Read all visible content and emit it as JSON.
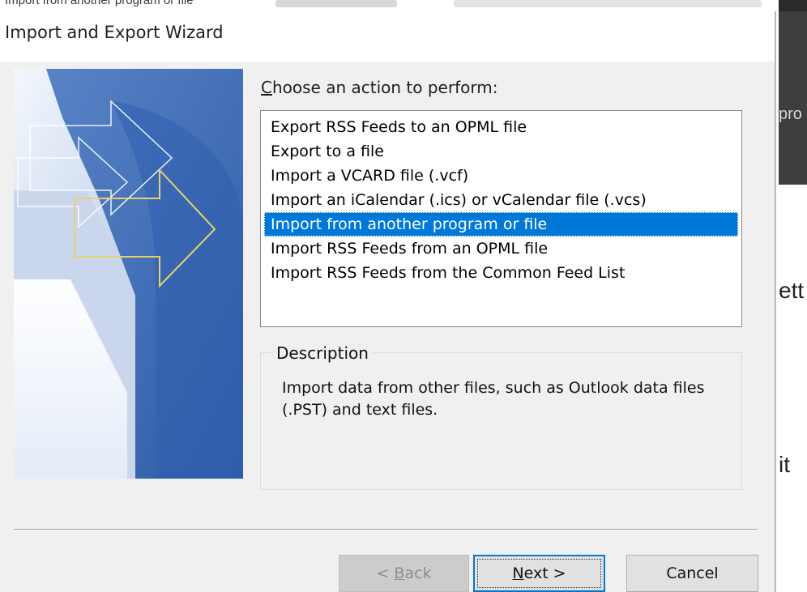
{
  "background": {
    "top_text": "Import from another program or file",
    "right_fragments": [
      "pro",
      "ett",
      "it"
    ]
  },
  "dialog": {
    "title": "Import and Export Wizard",
    "choose_label": {
      "mnemonic": "C",
      "rest": "hoose an action to perform:"
    },
    "actions": [
      {
        "label": "Export RSS Feeds to an OPML file",
        "selected": false
      },
      {
        "label": "Export to a file",
        "selected": false
      },
      {
        "label": "Import a VCARD file (.vcf)",
        "selected": false
      },
      {
        "label": "Import an iCalendar (.ics) or vCalendar file (.vcs)",
        "selected": false
      },
      {
        "label": "Import from another program or file",
        "selected": true
      },
      {
        "label": "Import RSS Feeds from an OPML file",
        "selected": false
      },
      {
        "label": "Import RSS Feeds from the Common Feed List",
        "selected": false
      }
    ],
    "description": {
      "legend": "Description",
      "text": "Import data from other files, such as Outlook data files (.PST) and text files."
    },
    "buttons": {
      "back": {
        "prefix": "< ",
        "mnemonic": "B",
        "rest": "ack",
        "enabled": false
      },
      "next": {
        "mnemonic": "N",
        "rest": "ext >",
        "enabled": true
      },
      "cancel": {
        "label": "Cancel",
        "enabled": true
      }
    },
    "icons": {
      "banner": "wizard-arrows-banner"
    }
  },
  "colors": {
    "selection": "#0078d7",
    "dialog_face": "#f0f0f0",
    "focus_border": "#0078d7"
  }
}
